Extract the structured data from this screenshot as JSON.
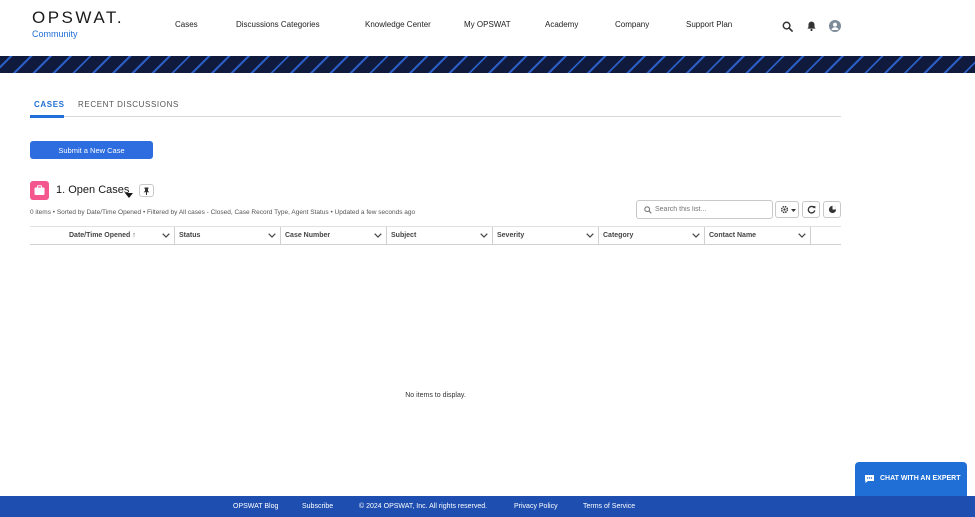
{
  "brand": {
    "name": "OPSWAT.",
    "sub": "Community"
  },
  "nav": {
    "items": [
      "Cases",
      "Discussions Categories",
      "Knowledge Center",
      "My OPSWAT",
      "Academy",
      "Company",
      "Support Plan"
    ]
  },
  "header_icons": [
    "search-icon",
    "bell-icon",
    "user-avatar-icon"
  ],
  "tabs": [
    {
      "label": "CASES",
      "active": true
    },
    {
      "label": "RECENT DISCUSSIONS",
      "active": false
    }
  ],
  "submit_button": "Submit a New Case",
  "list_view": {
    "title": "1. Open Cases",
    "meta": "0 items • Sorted by Date/Time Opened • Filtered by All cases - Closed, Case Record Type, Agent Status • Updated a few seconds ago",
    "search_placeholder": "Search this list...",
    "columns": [
      "Date/Time Opened ↑",
      "Status",
      "Case Number",
      "Subject",
      "Severity",
      "Category",
      "Contact Name"
    ],
    "empty_message": "No items to display."
  },
  "chat": {
    "label": "CHAT WITH AN EXPERT"
  },
  "footer": {
    "items": [
      "OPSWAT Blog",
      "Subscribe",
      "© 2024 OPSWAT, Inc. All rights reserved.",
      "Privacy Policy",
      "Terms of Service"
    ]
  },
  "colors": {
    "primary": "#2d6de0",
    "brand_blue": "#1f6fd6",
    "footer_bg": "#1e4fb0",
    "list_icon": "#f4568e",
    "banner_dark": "#0f1a3d"
  }
}
